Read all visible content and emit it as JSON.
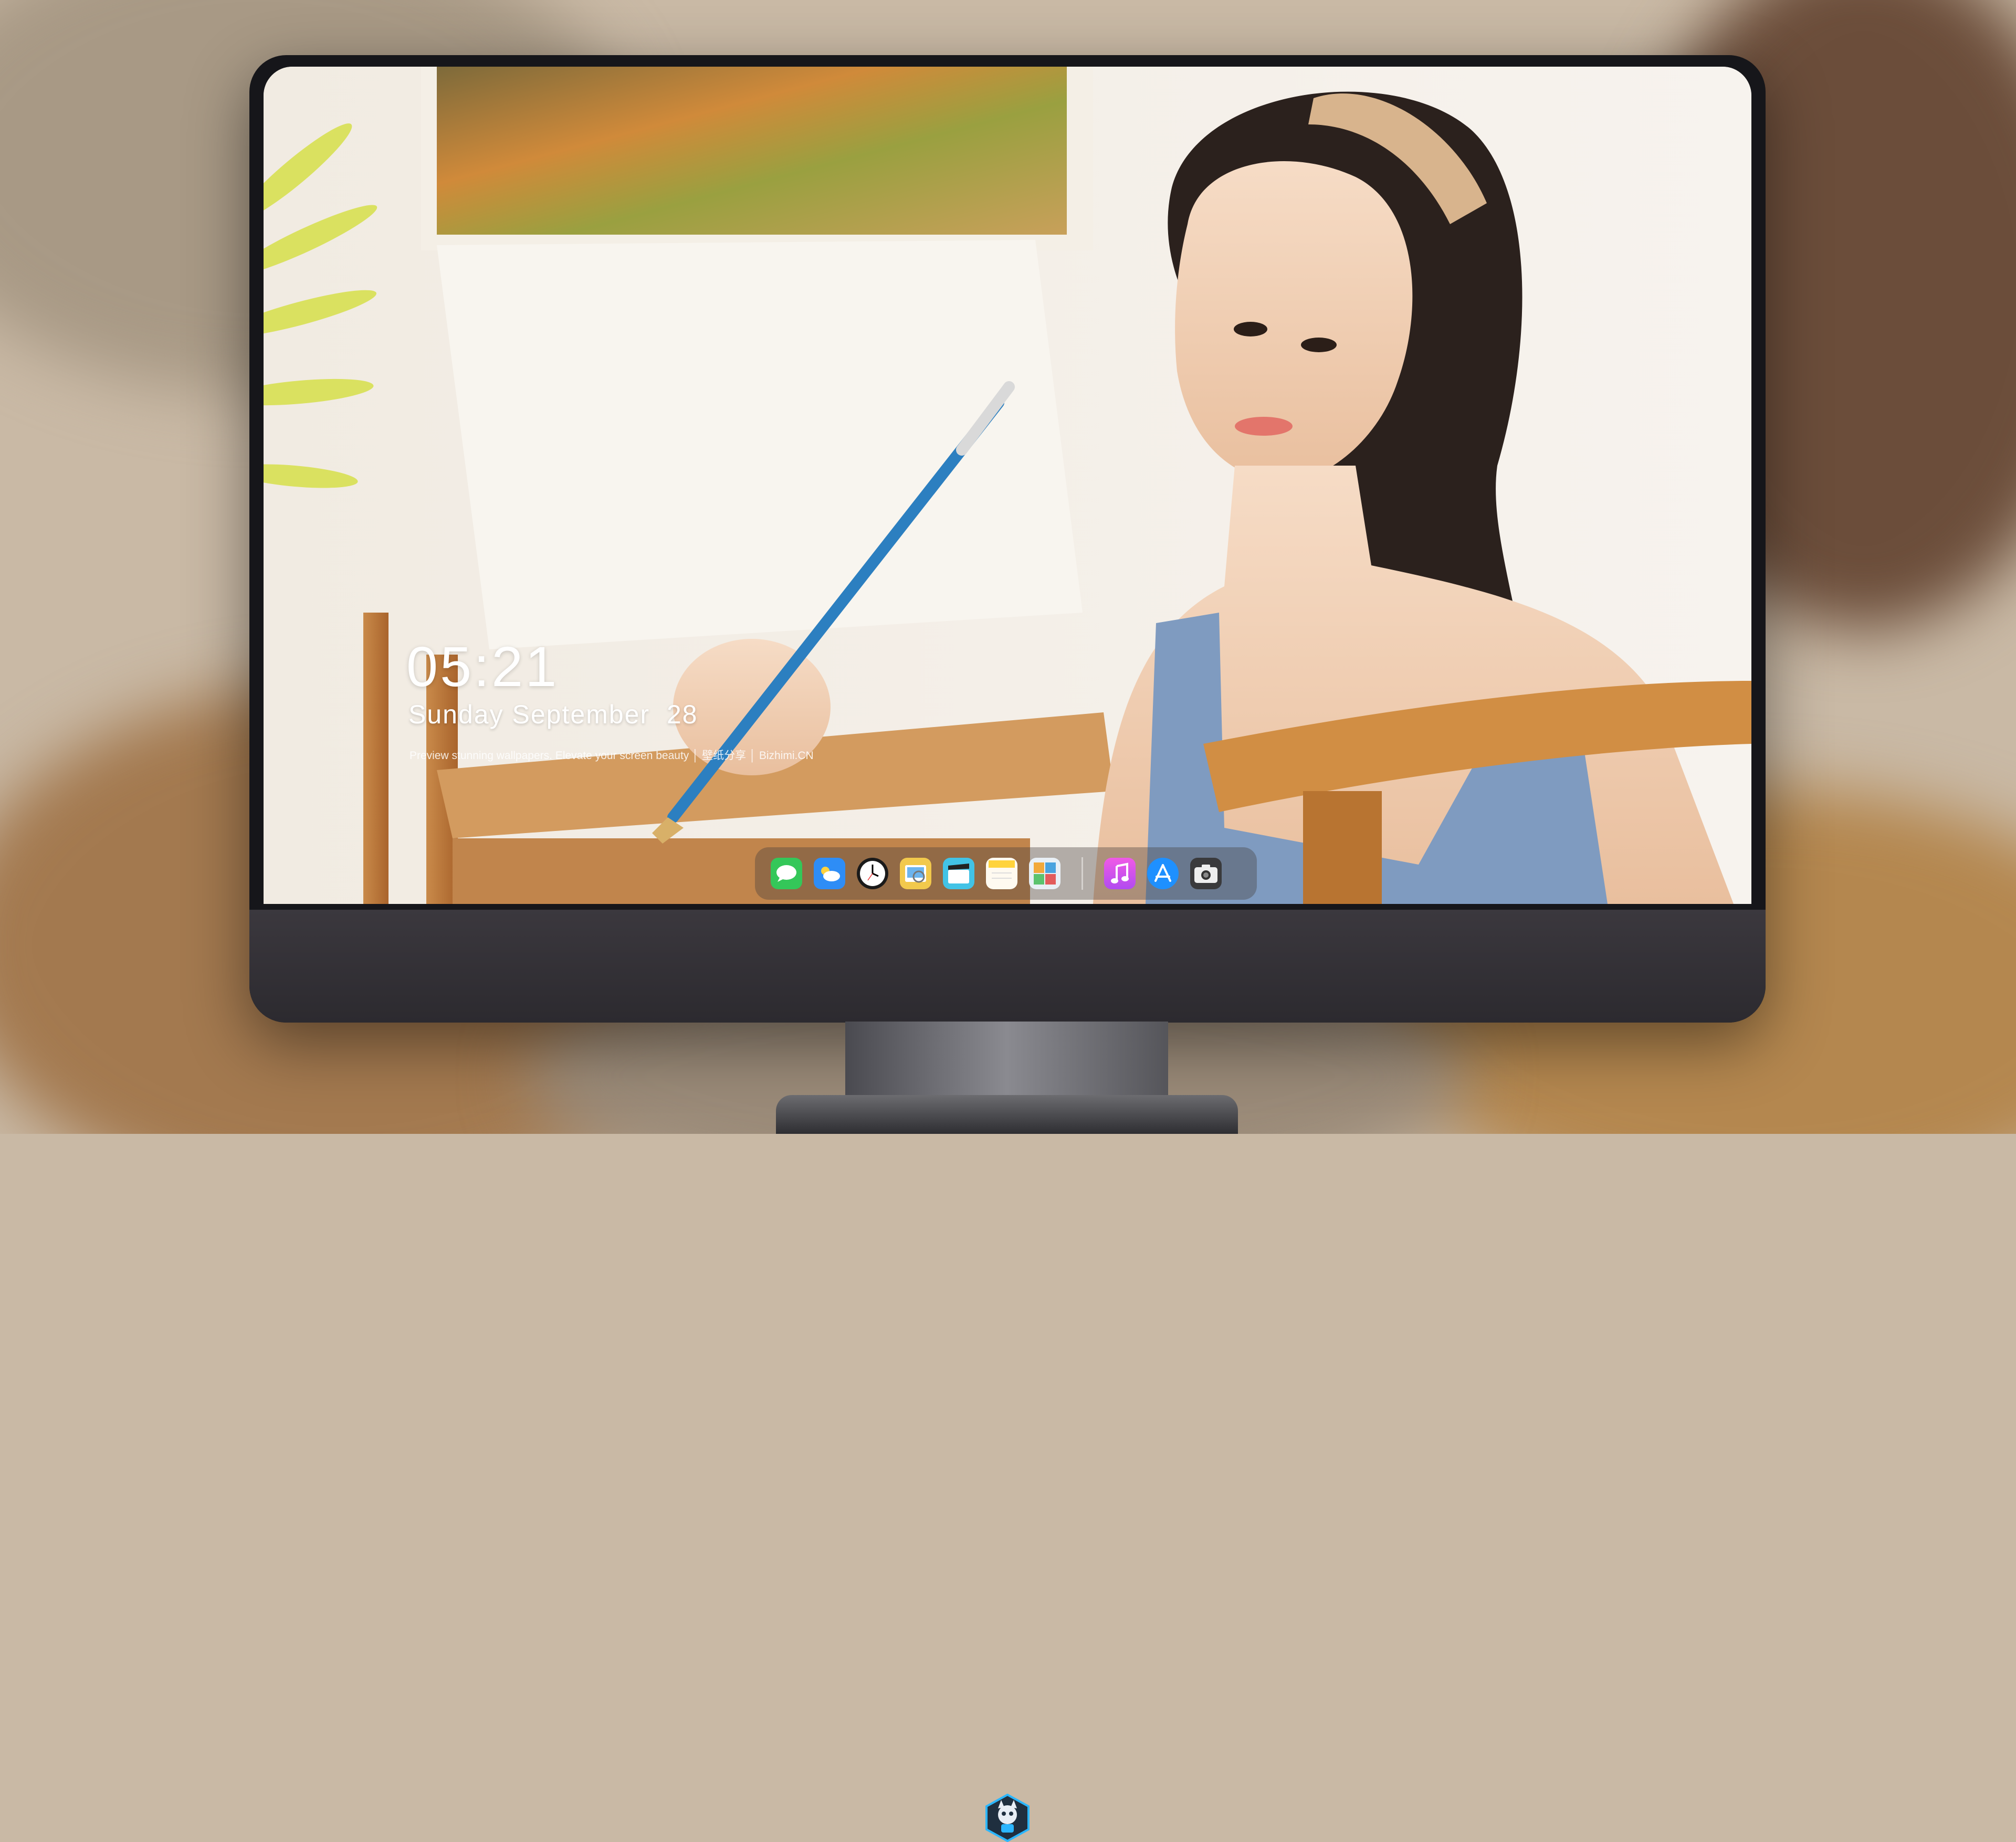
{
  "wallpaper": {
    "time": "05:21",
    "date_line": "Sunday September  28",
    "tagline": "Preview stunning wallpapers. Elevate your screen beauty │ 壁纸分享 │ Bizhimi.CN"
  },
  "dock": {
    "items": [
      {
        "name": "messages",
        "icon": "messages-icon",
        "color": "#34c759"
      },
      {
        "name": "weather",
        "icon": "weather-icon",
        "color": "#2e8df6"
      },
      {
        "name": "clock",
        "icon": "clock-icon",
        "color": "#1a1a1a"
      },
      {
        "name": "preview",
        "icon": "preview-icon",
        "color": "#f2c94c"
      },
      {
        "name": "video-clips",
        "icon": "clapperboard-icon",
        "color": "#42c3e6"
      },
      {
        "name": "notes",
        "icon": "notes-icon",
        "color": "#ffe27a"
      },
      {
        "name": "photo-booth",
        "icon": "photo-booth-icon",
        "color": "#4aa3df"
      },
      {
        "name": "music",
        "icon": "music-icon",
        "color": "#e64bd8"
      },
      {
        "name": "app-store",
        "icon": "app-store-icon",
        "color": "#1e90ff"
      },
      {
        "name": "camera",
        "icon": "camera-icon",
        "color": "#3a3a3c"
      }
    ]
  },
  "colors": {
    "bezel": "#16161a",
    "chin": "#353239",
    "logo_accent": "#2bb6ff"
  }
}
